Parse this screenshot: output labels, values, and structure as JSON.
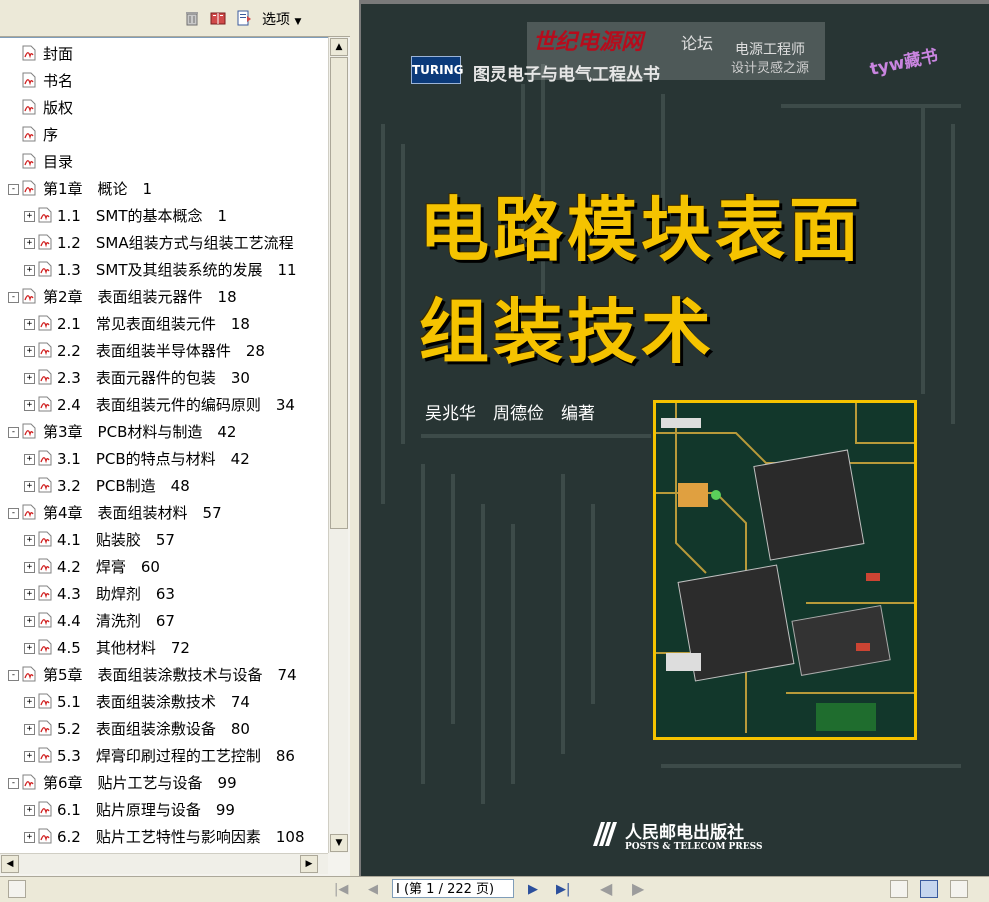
{
  "panel": {
    "options_label": "选项",
    "toolbar_icons": [
      "trash-icon",
      "bookmark-book-icon",
      "bookmark-properties-icon"
    ]
  },
  "bookmarks": [
    {
      "label": "封面",
      "indent": 0,
      "expand": null
    },
    {
      "label": "书名",
      "indent": 0,
      "expand": null
    },
    {
      "label": "版权",
      "indent": 0,
      "expand": null
    },
    {
      "label": "序",
      "indent": 0,
      "expand": null
    },
    {
      "label": "目录",
      "indent": 0,
      "expand": null
    },
    {
      "label": "第1章　概论　1",
      "indent": 0,
      "expand": "-"
    },
    {
      "label": "1.1　SMT的基本概念　1",
      "indent": 1,
      "expand": "+"
    },
    {
      "label": "1.2　SMA组装方式与组装工艺流程",
      "indent": 1,
      "expand": "+"
    },
    {
      "label": "1.3　SMT及其组装系统的发展　11",
      "indent": 1,
      "expand": "+"
    },
    {
      "label": "第2章　表面组装元器件　18",
      "indent": 0,
      "expand": "-"
    },
    {
      "label": "2.1　常见表面组装元件　18",
      "indent": 1,
      "expand": "+"
    },
    {
      "label": "2.2　表面组装半导体器件　28",
      "indent": 1,
      "expand": "+"
    },
    {
      "label": "2.3　表面元器件的包装　30",
      "indent": 1,
      "expand": "+"
    },
    {
      "label": "2.4　表面组装元件的编码原则　34",
      "indent": 1,
      "expand": "+"
    },
    {
      "label": "第3章　PCB材料与制造　42",
      "indent": 0,
      "expand": "-"
    },
    {
      "label": "3.1　PCB的特点与材料　42",
      "indent": 1,
      "expand": "+"
    },
    {
      "label": "3.2　PCB制造　48",
      "indent": 1,
      "expand": "+"
    },
    {
      "label": "第4章　表面组装材料　57",
      "indent": 0,
      "expand": "-"
    },
    {
      "label": "4.1　贴装胶　57",
      "indent": 1,
      "expand": "+"
    },
    {
      "label": "4.2　焊膏　60",
      "indent": 1,
      "expand": "+"
    },
    {
      "label": "4.3　助焊剂　63",
      "indent": 1,
      "expand": "+"
    },
    {
      "label": "4.4　清洗剂　67",
      "indent": 1,
      "expand": "+"
    },
    {
      "label": "4.5　其他材料　72",
      "indent": 1,
      "expand": "+"
    },
    {
      "label": "第5章　表面组装涂敷技术与设备　74",
      "indent": 0,
      "expand": "-"
    },
    {
      "label": "5.1　表面组装涂敷技术　74",
      "indent": 1,
      "expand": "+"
    },
    {
      "label": "5.2　表面组装涂敷设备　80",
      "indent": 1,
      "expand": "+"
    },
    {
      "label": "5.3　焊膏印刷过程的工艺控制　86",
      "indent": 1,
      "expand": "+"
    },
    {
      "label": "第6章　贴片工艺与设备　99",
      "indent": 0,
      "expand": "-"
    },
    {
      "label": "6.1　贴片原理与设备　99",
      "indent": 1,
      "expand": "+"
    },
    {
      "label": "6.2　贴片工艺特性与影响因素　108",
      "indent": 1,
      "expand": "+"
    }
  ],
  "cover": {
    "turing_logo": "TURING",
    "series": "图灵电子与电气工程丛书",
    "title_line1": "电路模块表面",
    "title_line2": "组装技术",
    "authors": "吴兆华　周德俭　编著",
    "publisher": "人民邮电出版社",
    "publisher_en": "POSTS & TELECOM PRESS"
  },
  "watermark": {
    "site": "世纪电源网",
    "forum": "论坛",
    "engineer": "电源工程师",
    "slogan": "设计灵感之源",
    "tag": "tyw藏书"
  },
  "status": {
    "page_indicator": "I (第 1 / 222 页)",
    "current_page": 1,
    "total_pages": 222
  },
  "colors": {
    "title_yellow": "#f5c300",
    "cover_bg": "#283534",
    "watermark_red": "#b60c1c"
  }
}
